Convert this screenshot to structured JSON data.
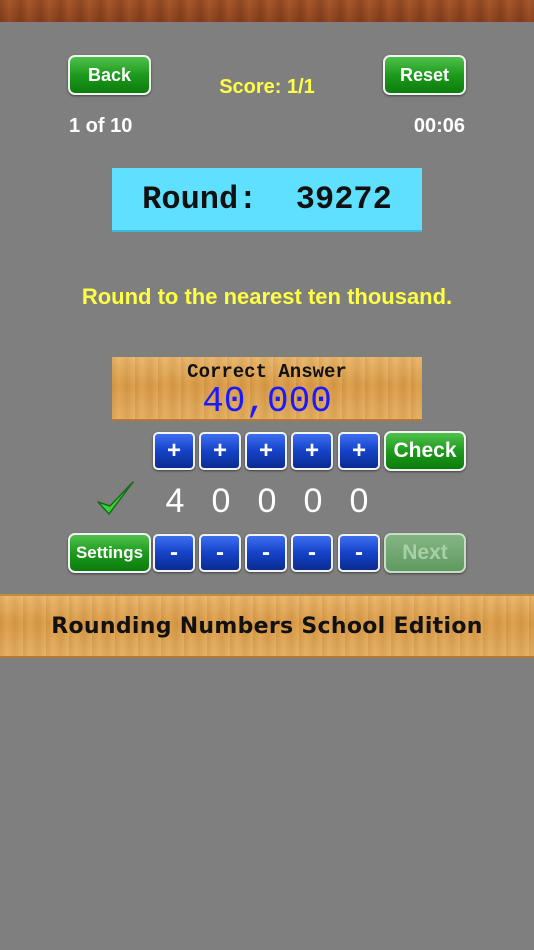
{
  "header": {
    "back_label": "Back",
    "reset_label": "Reset",
    "score": "Score: 1/1",
    "progress": "1 of 10",
    "timer": "00:06"
  },
  "problem": {
    "text": "Round:  39272",
    "instruction": "Round to the nearest ten thousand."
  },
  "answer_panel": {
    "title": "Correct Answer",
    "value": "40,000"
  },
  "controls": {
    "plus_label": "+",
    "minus_label": "-",
    "check_label": "Check",
    "settings_label": "Settings",
    "next_label": "Next",
    "digits": [
      "4",
      "0",
      "0",
      "0",
      "0"
    ]
  },
  "footer": {
    "title": "Rounding Numbers School Edition"
  },
  "colors": {
    "background": "#7f7f7f",
    "instruction": "#ffff44",
    "answer_value": "#1a1aff",
    "problem_box": "#5fe0ff"
  }
}
